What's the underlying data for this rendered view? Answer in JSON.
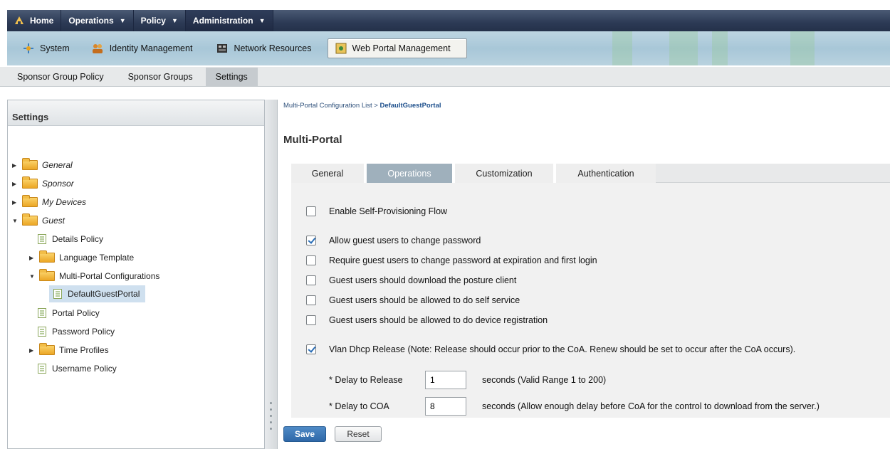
{
  "topnav": {
    "items": [
      {
        "label": "Home"
      },
      {
        "label": "Operations"
      },
      {
        "label": "Policy"
      },
      {
        "label": "Administration"
      }
    ]
  },
  "subnav": {
    "items": [
      {
        "label": "System",
        "icon": "system-icon"
      },
      {
        "label": "Identity Management",
        "icon": "identity-icon"
      },
      {
        "label": "Network Resources",
        "icon": "network-icon"
      },
      {
        "label": "Web Portal Management",
        "icon": "web-portal-icon"
      }
    ]
  },
  "tabbar": {
    "items": [
      {
        "label": "Sponsor Group Policy"
      },
      {
        "label": "Sponsor Groups"
      },
      {
        "label": "Settings"
      }
    ]
  },
  "leftpanel": {
    "title": "Settings",
    "tree": [
      {
        "label": "General"
      },
      {
        "label": "Sponsor"
      },
      {
        "label": "My Devices"
      },
      {
        "label": "Guest"
      },
      {
        "label": "Details Policy"
      },
      {
        "label": "Language Template"
      },
      {
        "label": "Multi-Portal Configurations"
      },
      {
        "label": "DefaultGuestPortal"
      },
      {
        "label": "Portal Policy"
      },
      {
        "label": "Password Policy"
      },
      {
        "label": "Time Profiles"
      },
      {
        "label": "Username Policy"
      }
    ]
  },
  "breadcrumb": {
    "parent": "Multi-Portal Configuration List",
    "separator": ">",
    "current": "DefaultGuestPortal"
  },
  "page_title": "Multi-Portal",
  "tabs": [
    {
      "label": "General"
    },
    {
      "label": "Operations"
    },
    {
      "label": "Customization"
    },
    {
      "label": "Authentication"
    }
  ],
  "options": [
    {
      "label": "Enable Self-Provisioning Flow",
      "checked": false
    },
    {
      "label": "Allow guest users to change password",
      "checked": true
    },
    {
      "label": "Require guest users to change password at expiration and first login",
      "checked": false
    },
    {
      "label": "Guest users should download the posture client",
      "checked": false
    },
    {
      "label": "Guest users should be allowed to do self service",
      "checked": false
    },
    {
      "label": "Guest users should be allowed to do device registration",
      "checked": false
    },
    {
      "label": "Vlan Dhcp Release (Note: Release should occur prior to the CoA. Renew should be set to occur after the CoA occurs).",
      "checked": true
    }
  ],
  "fields": [
    {
      "label": "* Delay to Release",
      "value": "1",
      "hint": "seconds (Valid Range 1 to 200)"
    },
    {
      "label": "* Delay to COA",
      "value": "8",
      "hint": "seconds  (Allow enough delay before CoA for the control to download from the server.)"
    }
  ],
  "buttons": {
    "save": "Save",
    "reset": "Reset"
  },
  "colors": {
    "topnav_bg": "#2c3a55",
    "subnav_bg": "#a8c7d8",
    "active_tab": "#9fb0bc",
    "save_button": "#2f68a8"
  }
}
